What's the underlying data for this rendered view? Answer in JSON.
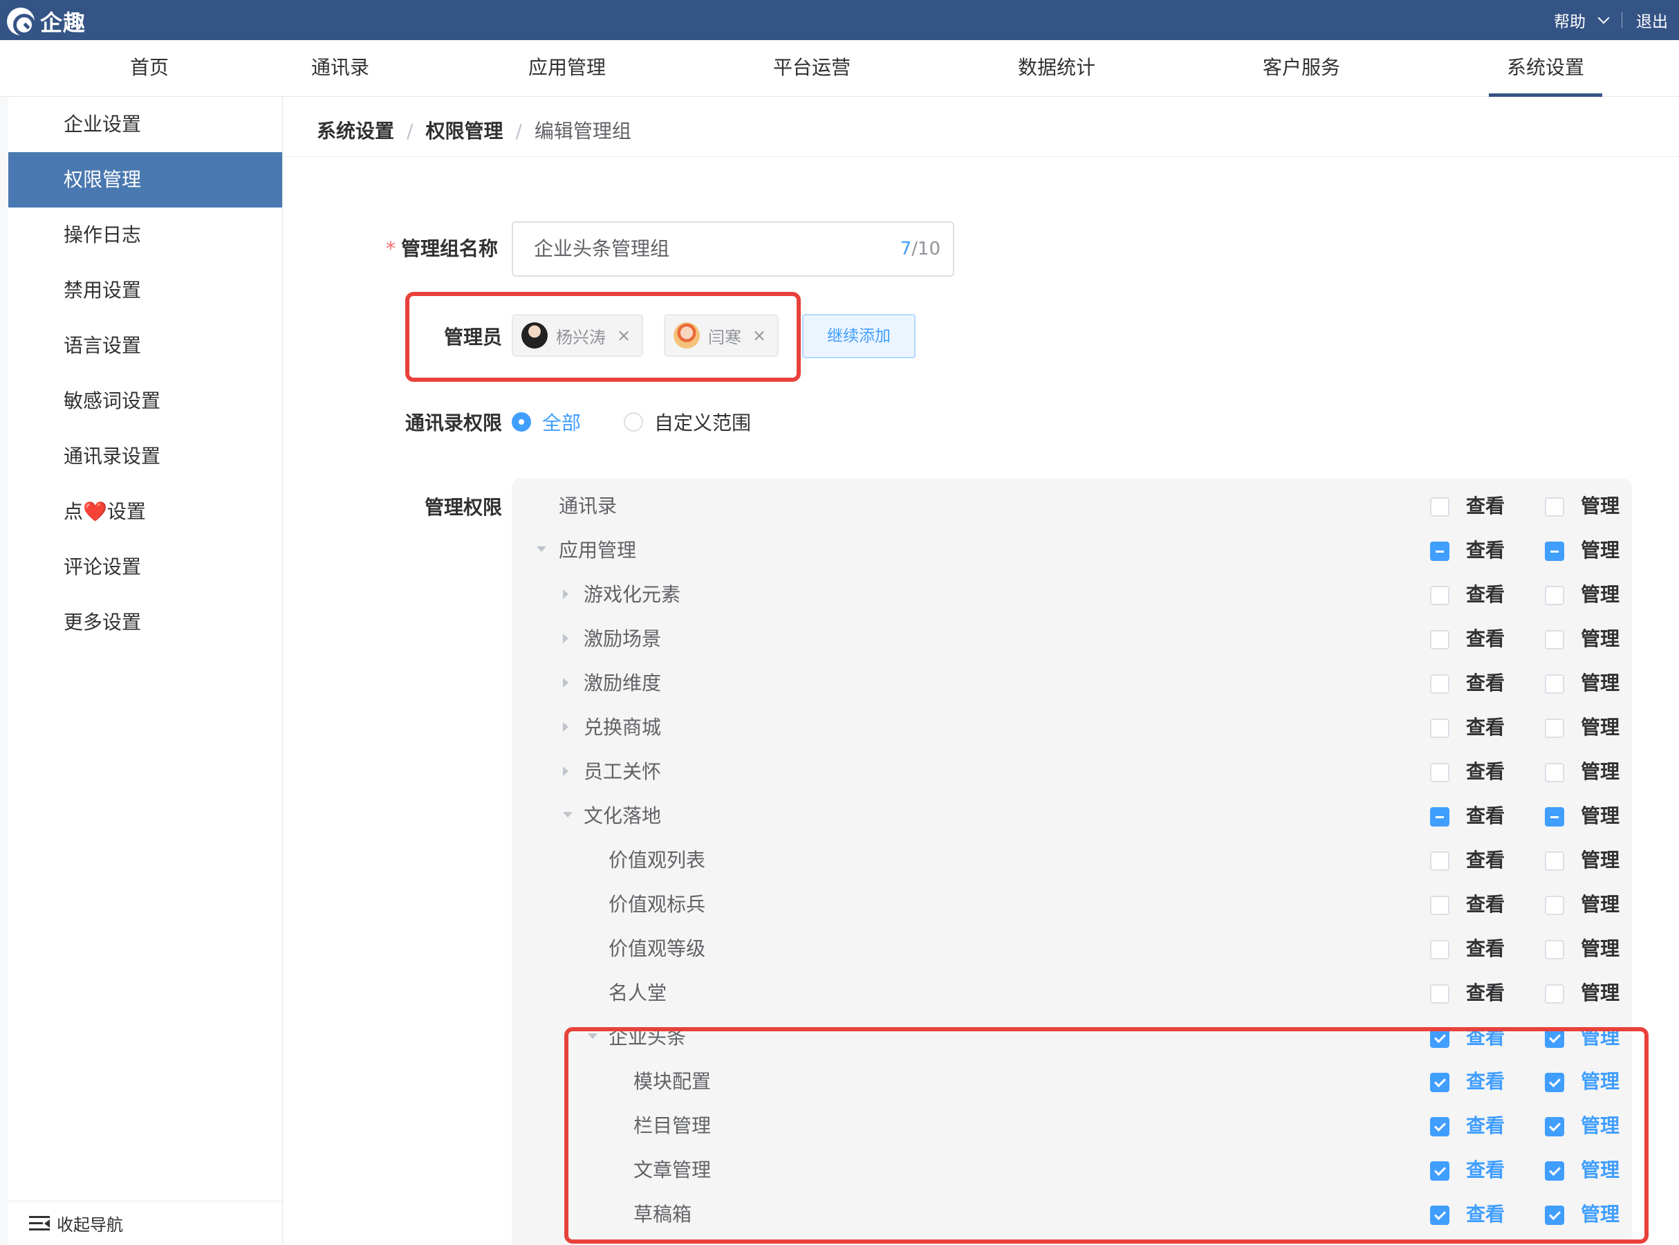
{
  "topbar": {
    "logo_text": "企趣",
    "help": "帮助",
    "logout": "退出"
  },
  "nav": {
    "items": [
      "首页",
      "通讯录",
      "应用管理",
      "平台运营",
      "数据统计",
      "客户服务",
      "系统设置"
    ],
    "active": "系统设置"
  },
  "sidebar": {
    "items": [
      "企业设置",
      "权限管理",
      "操作日志",
      "禁用设置",
      "语言设置",
      "敏感词设置",
      "通讯录设置",
      "点❤️设置",
      "评论设置",
      "更多设置"
    ],
    "active": "权限管理",
    "collapse": "收起导航"
  },
  "breadcrumb": [
    "系统设置",
    "权限管理",
    "编辑管理组"
  ],
  "form": {
    "name_label": "管理组名称",
    "required_mark": "*",
    "name_value": "企业头条管理组",
    "count_current": "7",
    "count_max": "/10",
    "admin_label": "管理员",
    "admins": [
      "杨兴涛",
      "闫寒"
    ],
    "add_button": "继续添加",
    "contact_label": "通讯录权限",
    "contact_options": [
      "全部",
      "自定义范围"
    ],
    "contact_selected": "全部",
    "perm_label": "管理权限"
  },
  "permissions": {
    "view_label": "查看",
    "manage_label": "管理",
    "rows": [
      {
        "label": "通讯录",
        "level": 0,
        "caret": "none",
        "view": "off",
        "manage": "off"
      },
      {
        "label": "应用管理",
        "level": 0,
        "caret": "down",
        "view": "ind",
        "manage": "ind"
      },
      {
        "label": "游戏化元素",
        "level": 1,
        "caret": "right",
        "view": "off",
        "manage": "off"
      },
      {
        "label": "激励场景",
        "level": 1,
        "caret": "right",
        "view": "off",
        "manage": "off"
      },
      {
        "label": "激励维度",
        "level": 1,
        "caret": "right",
        "view": "off",
        "manage": "off"
      },
      {
        "label": "兑换商城",
        "level": 1,
        "caret": "right",
        "view": "off",
        "manage": "off"
      },
      {
        "label": "员工关怀",
        "level": 1,
        "caret": "right",
        "view": "off",
        "manage": "off"
      },
      {
        "label": "文化落地",
        "level": 1,
        "caret": "down",
        "view": "ind",
        "manage": "ind"
      },
      {
        "label": "价值观列表",
        "level": 2,
        "caret": "none",
        "view": "off",
        "manage": "off"
      },
      {
        "label": "价值观标兵",
        "level": 2,
        "caret": "none",
        "view": "off",
        "manage": "off"
      },
      {
        "label": "价值观等级",
        "level": 2,
        "caret": "none",
        "view": "off",
        "manage": "off"
      },
      {
        "label": "名人堂",
        "level": 2,
        "caret": "none",
        "view": "off",
        "manage": "off"
      },
      {
        "label": "企业头条",
        "level": 2,
        "caret": "down",
        "view": "chk",
        "manage": "chk"
      },
      {
        "label": "模块配置",
        "level": 3,
        "caret": "none",
        "view": "chk",
        "manage": "chk"
      },
      {
        "label": "栏目管理",
        "level": 3,
        "caret": "none",
        "view": "chk",
        "manage": "chk"
      },
      {
        "label": "文章管理",
        "level": 3,
        "caret": "none",
        "view": "chk",
        "manage": "chk"
      },
      {
        "label": "草稿箱",
        "level": 3,
        "caret": "none",
        "view": "chk",
        "manage": "chk"
      }
    ]
  },
  "colors": {
    "topbar": "#355486",
    "active_side": "#4a78b0",
    "primary": "#409eff",
    "highlight": "#e8413c"
  }
}
